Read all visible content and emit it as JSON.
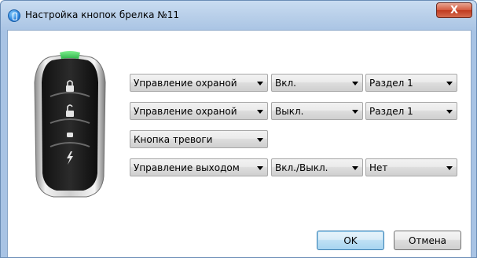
{
  "window": {
    "title": "Настройка кнопок брелка №11",
    "close_symbol": "X",
    "icon": "app-info-icon"
  },
  "keyfob": {
    "icon": "keyfob-image",
    "buttons": [
      "lock-icon",
      "unlock-icon",
      "alarm-icon",
      "output-lightning-icon"
    ],
    "led_color": "#4dd06a"
  },
  "rows": [
    {
      "function": "Управление охраной",
      "action": "Вкл.",
      "target": "Раздел 1"
    },
    {
      "function": "Управление охраной",
      "action": "Выкл.",
      "target": "Раздел 1"
    },
    {
      "function": "Кнопка тревоги"
    },
    {
      "function": "Управление выходом",
      "action": "Вкл./Выкл.",
      "target": "Нет"
    }
  ],
  "footer": {
    "ok_label": "OK",
    "cancel_label": "Отмена"
  }
}
